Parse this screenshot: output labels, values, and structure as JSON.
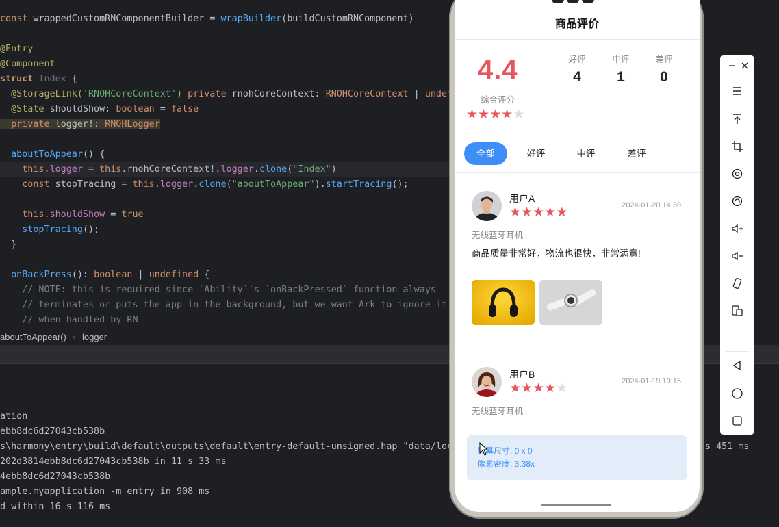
{
  "editor": {
    "lines": [
      [
        [
          "kw",
          "const "
        ],
        [
          "ty",
          "wrappedCustomRNComponentBuilder = "
        ],
        [
          "fn",
          "wrapBuilder"
        ],
        [
          "ty",
          "(buildCustomRNComponent)"
        ]
      ],
      [],
      [
        [
          "ann",
          "@Entry"
        ]
      ],
      [
        [
          "ann",
          "@Component"
        ]
      ],
      [
        [
          "kwb",
          "struct "
        ],
        [
          "dim",
          "Index "
        ],
        [
          "ty",
          "{"
        ]
      ],
      [
        [
          "ann",
          "  @StorageLink("
        ],
        [
          "str",
          "'RNOHCoreContext'"
        ],
        [
          "ann",
          ") "
        ],
        [
          "kw",
          "private "
        ],
        [
          "ty",
          "rnohCoreContext: "
        ],
        [
          "tyo",
          "RNOHCoreContext"
        ],
        [
          "ty",
          " | "
        ],
        [
          "kw",
          "undefi"
        ]
      ],
      [
        [
          "ann",
          "  @State "
        ],
        [
          "ty",
          "shouldShow: "
        ],
        [
          "kw",
          "boolean"
        ],
        [
          "ty",
          " = "
        ],
        [
          "kw",
          "false"
        ]
      ],
      [
        [
          "kw",
          "  private "
        ],
        [
          "ty",
          "logger!: "
        ],
        [
          "tyo",
          "RNOHLogger"
        ]
      ],
      [],
      [
        [
          "fn",
          "  aboutToAppear"
        ],
        [
          "ty",
          "() {"
        ]
      ],
      [
        [
          "kw",
          "    this"
        ],
        [
          "ty",
          "."
        ],
        [
          "purple",
          "logger"
        ],
        [
          "ty",
          " = "
        ],
        [
          "kw",
          "this"
        ],
        [
          "ty",
          ".rnohCoreContext!."
        ],
        [
          "purple",
          "logger"
        ],
        [
          "ty",
          "."
        ],
        [
          "fn",
          "clone"
        ],
        [
          "ty",
          "("
        ],
        [
          "str",
          "\"Index\""
        ],
        [
          "ty",
          ")"
        ]
      ],
      [
        [
          "kw",
          "    const "
        ],
        [
          "ty",
          "stopTracing = "
        ],
        [
          "kw",
          "this"
        ],
        [
          "ty",
          "."
        ],
        [
          "purple",
          "logger"
        ],
        [
          "ty",
          "."
        ],
        [
          "fn",
          "clone"
        ],
        [
          "ty",
          "("
        ],
        [
          "str",
          "\"aboutToAppear\""
        ],
        [
          "ty",
          ")."
        ],
        [
          "fn",
          "startTracing"
        ],
        [
          "ty",
          "();"
        ]
      ],
      [],
      [
        [
          "kw",
          "    this"
        ],
        [
          "ty",
          "."
        ],
        [
          "purple",
          "shouldShow"
        ],
        [
          "ty",
          " = "
        ],
        [
          "kw",
          "true"
        ]
      ],
      [
        [
          "fn",
          "    stopTracing"
        ],
        [
          "ty",
          "();"
        ]
      ],
      [
        [
          "ty",
          "  }"
        ]
      ],
      [],
      [
        [
          "fn",
          "  onBackPress"
        ],
        [
          "ty",
          "(): "
        ],
        [
          "kw",
          "boolean"
        ],
        [
          "ty",
          " | "
        ],
        [
          "kw",
          "undefined"
        ],
        [
          "ty",
          " {"
        ]
      ],
      [
        [
          "cm",
          "    // NOTE: this is required since `Ability`'s `onBackPressed` function always"
        ]
      ],
      [
        [
          "cm",
          "    // terminates or puts the app in the background, but we want Ark to ignore it c"
        ]
      ],
      [
        [
          "cm",
          "    // when handled by RN"
        ]
      ]
    ]
  },
  "breadcrumb": {
    "item1": "aboutToAppear()",
    "item2": "logger"
  },
  "console": {
    "lines": [
      "ation",
      "ebb8dc6d27043cb538b",
      "s\\harmony\\entry\\build\\default\\outputs\\default\\entry-default-unsigned.hap \"data/loc",
      "202d3814ebb8dc6d27043cb538b in 11 s 33 ms",
      "4ebb8dc6d27043cb538b",
      "ample.myapplication -m entry in 908 ms",
      "d within 16 s 116 ms"
    ],
    "right_text": "s 451 ms"
  },
  "app": {
    "title": "商品评价",
    "overall_score": "4.4",
    "overall_label": "综合评分",
    "overall_stars": 4,
    "stats": [
      {
        "label": "好评",
        "value": "4"
      },
      {
        "label": "中评",
        "value": "1"
      },
      {
        "label": "差评",
        "value": "0"
      }
    ],
    "tabs": [
      "全部",
      "好评",
      "中评",
      "差评"
    ],
    "active_tab": 0,
    "reviews": [
      {
        "user": "用户A",
        "stars": 5,
        "date": "2024-01-20 14:30",
        "product": "无线蓝牙耳机",
        "text": "商品质量非常好，物流也很快，非常满意!"
      },
      {
        "user": "用户B",
        "stars": 4,
        "date": "2024-01-19 10:15",
        "product": "无线蓝牙耳机",
        "text": ""
      }
    ],
    "info": {
      "screen_size": "屏幕尺寸: 0 x 0",
      "pixel_density": "像素密度: 3.38x"
    }
  },
  "toolbar": {
    "icons": [
      "minimize-icon",
      "close-icon",
      "menu-icon",
      "pin-top-icon",
      "crop-icon",
      "rotate-icon",
      "screenshot-icon",
      "volume-up-icon",
      "volume-down-icon",
      "shake-icon",
      "multi-device-icon",
      "back-icon",
      "home-icon",
      "recents-icon"
    ]
  },
  "colors": {
    "accent_red": "#e8555a",
    "accent_blue": "#3d8ef7",
    "ide_bg": "#1e1f22"
  }
}
